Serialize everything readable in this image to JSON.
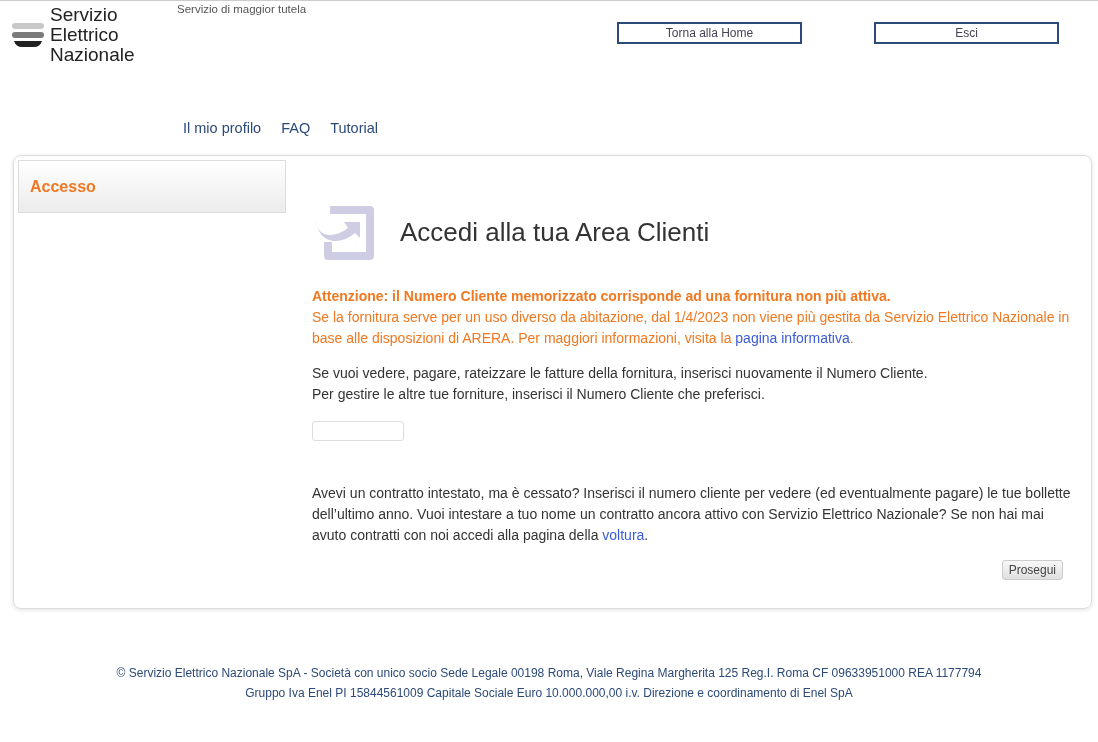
{
  "header": {
    "logo_lines": [
      "Servizio",
      "Elettrico",
      "Nazionale"
    ],
    "tagline": "Servizio di maggior tutela",
    "buttons": [
      "Torna alla Home",
      "Esci"
    ]
  },
  "nav": [
    "Il mio profilo",
    "FAQ",
    "Tutorial"
  ],
  "sidebar": {
    "items": [
      {
        "label": "Accesso",
        "selected": true
      }
    ]
  },
  "main": {
    "title": "Accedi alla tua Area Clienti",
    "warning": {
      "title": "Attenzione: il Numero Cliente memorizzato corrisponde ad una fornitura non più attiva.",
      "text_before": "Se la fornitura serve per un uso diverso da abitazione, dal 1/4/2023 non viene più gestita da Servizio Elettrico Nazionale in base alle disposizioni di ARERA. Per maggiori informazioni, visita la ",
      "link": "pagina informativa",
      "text_after": "."
    },
    "instructions": [
      "Se vuoi vedere, pagare, rateizzare le fatture della fornitura, inserisci nuovamente il Numero Cliente.",
      "Per gestire le altre tue forniture, inserisci il Numero Cliente che preferisci."
    ],
    "ceased": {
      "text_before": "Avevi un contratto intestato, ma è cessato? Inserisci il numero cliente per vedere (ed eventualmente pagare) le tue bollette dell’ultimo anno. Vuoi intestare a tuo nome un contratto ancora attivo con Servizio Elettrico Nazionale? Se non hai mai avuto contratti con noi accedi alla pagina della ",
      "link": "voltura",
      "text_after": "."
    },
    "submit": "Prosegui"
  },
  "footer": [
    "© Servizio Elettrico Nazionale SpA - Società con unico socio Sede Legale 00198 Roma, Viale Regina Margherita 125 Reg.I. Roma CF 09633951000 REA 1177794",
    "Gruppo Iva Enel PI 15844561009 Capitale Sociale Euro 10.000.000,00 i.v. Direzione e coordinamento di Enel SpA"
  ]
}
